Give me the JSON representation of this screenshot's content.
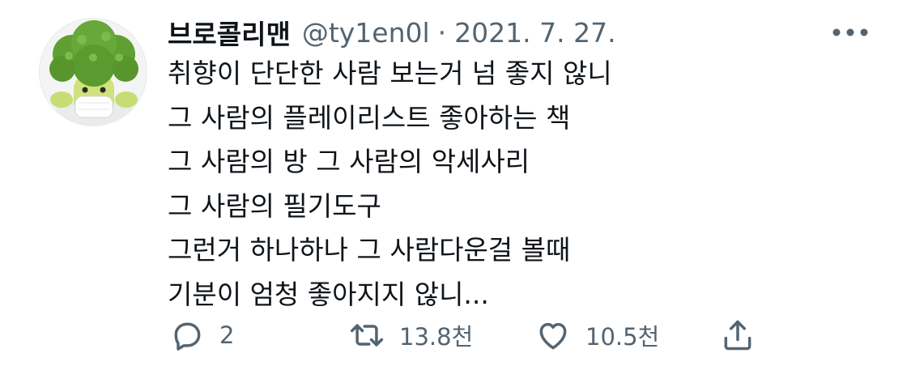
{
  "tweet": {
    "display_name": "브로콜리맨",
    "handle": "@ty1en0l",
    "separator": "·",
    "date": "2021. 7. 27.",
    "lines": [
      "취향이 단단한 사람 보는거 넘 좋지 않니",
      "그 사람의 플레이리스트 좋아하는 책",
      "그 사람의 방 그 사람의 악세사리",
      "그 사람의 필기도구",
      "그런거 하나하나 그 사람다운걸 볼때",
      "기분이 엄청 좋아지지 않니..."
    ]
  },
  "actions": {
    "reply": {
      "icon": "reply-icon",
      "count": "2"
    },
    "retweet": {
      "icon": "retweet-icon",
      "count": "13.8천"
    },
    "like": {
      "icon": "heart-icon",
      "count": "10.5천"
    },
    "share": {
      "icon": "share-icon"
    }
  },
  "colors": {
    "text_primary": "#0f1419",
    "text_secondary": "#536471",
    "avatar_broccoli": "#5a9a2e"
  }
}
